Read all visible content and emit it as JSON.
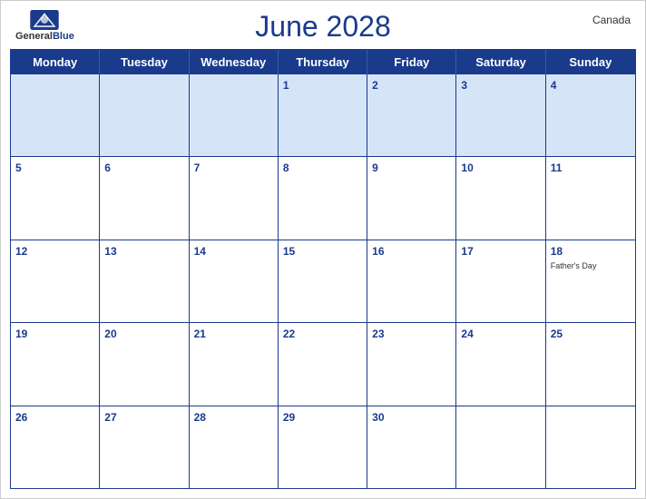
{
  "header": {
    "logo_general": "General",
    "logo_blue": "Blue",
    "title": "June 2028",
    "country": "Canada"
  },
  "days_of_week": [
    "Monday",
    "Tuesday",
    "Wednesday",
    "Thursday",
    "Friday",
    "Saturday",
    "Sunday"
  ],
  "weeks": [
    [
      {
        "num": "",
        "event": ""
      },
      {
        "num": "",
        "event": ""
      },
      {
        "num": "",
        "event": ""
      },
      {
        "num": "1",
        "event": ""
      },
      {
        "num": "2",
        "event": ""
      },
      {
        "num": "3",
        "event": ""
      },
      {
        "num": "4",
        "event": ""
      }
    ],
    [
      {
        "num": "5",
        "event": ""
      },
      {
        "num": "6",
        "event": ""
      },
      {
        "num": "7",
        "event": ""
      },
      {
        "num": "8",
        "event": ""
      },
      {
        "num": "9",
        "event": ""
      },
      {
        "num": "10",
        "event": ""
      },
      {
        "num": "11",
        "event": ""
      }
    ],
    [
      {
        "num": "12",
        "event": ""
      },
      {
        "num": "13",
        "event": ""
      },
      {
        "num": "14",
        "event": ""
      },
      {
        "num": "15",
        "event": ""
      },
      {
        "num": "16",
        "event": ""
      },
      {
        "num": "17",
        "event": ""
      },
      {
        "num": "18",
        "event": "Father's Day"
      }
    ],
    [
      {
        "num": "19",
        "event": ""
      },
      {
        "num": "20",
        "event": ""
      },
      {
        "num": "21",
        "event": ""
      },
      {
        "num": "22",
        "event": ""
      },
      {
        "num": "23",
        "event": ""
      },
      {
        "num": "24",
        "event": ""
      },
      {
        "num": "25",
        "event": ""
      }
    ],
    [
      {
        "num": "26",
        "event": ""
      },
      {
        "num": "27",
        "event": ""
      },
      {
        "num": "28",
        "event": ""
      },
      {
        "num": "29",
        "event": ""
      },
      {
        "num": "30",
        "event": ""
      },
      {
        "num": "",
        "event": ""
      },
      {
        "num": "",
        "event": ""
      }
    ]
  ],
  "colors": {
    "header_bg": "#1a3a8c",
    "cell_header_bg": "#d6e4f7",
    "text_blue": "#1a3a8c"
  }
}
